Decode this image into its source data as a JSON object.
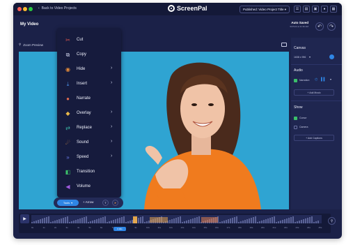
{
  "titlebar": {
    "back_label": "Back to Video Projects",
    "app_name": "ScreenPal",
    "publish_status": "Published: Video Project Title",
    "icons": [
      "list-icon",
      "captions-icon",
      "cc-icon",
      "user-icon",
      "layout-icon"
    ]
  },
  "header": {
    "project_title": "My Video",
    "autosave_label": "Auto Saved",
    "autosave_time": "9/27/22 at 11:36 AM",
    "undo_icon": "undo-icon",
    "redo_icon": "redo-icon"
  },
  "preview": {
    "zoom_label": "Zoom Preview"
  },
  "panel": {
    "canvas_title": "Canvas",
    "canvas_size": "1638 x 996",
    "audio_title": "Audio",
    "narration_label": "Narration",
    "add_music_label": "+ Add Music",
    "show_title": "Show",
    "cursor_label": "Cursor",
    "camera_label": "Camera",
    "add_captions_label": "+ Add Captions",
    "accent": "#2f86e5"
  },
  "menu": {
    "items": [
      {
        "label": "Cut",
        "icon": "scissors-icon",
        "color": "#e2584f",
        "submenu": false
      },
      {
        "label": "Copy",
        "icon": "copy-icon",
        "color": "#c9cde6",
        "submenu": false
      },
      {
        "label": "Hide",
        "icon": "eye-hidden-icon",
        "color": "#e38a3a",
        "submenu": true
      },
      {
        "label": "Insert",
        "icon": "insert-icon",
        "color": "#4a8fe8",
        "submenu": true
      },
      {
        "label": "Narrate",
        "icon": "microphone-icon",
        "color": "#e06b4f",
        "submenu": false
      },
      {
        "label": "Overlay",
        "icon": "layers-icon",
        "color": "#e8b84a",
        "submenu": true
      },
      {
        "label": "Replace",
        "icon": "replace-icon",
        "color": "#3ab8a8",
        "submenu": true
      },
      {
        "label": "Sound",
        "icon": "speaker-icon",
        "color": "#e8974a",
        "submenu": true
      },
      {
        "label": "Speed",
        "icon": "speed-icon",
        "color": "#6a7be8",
        "submenu": true
      },
      {
        "label": "Transition",
        "icon": "transition-icon",
        "color": "#3bbf6a",
        "submenu": false
      },
      {
        "label": "Volume",
        "icon": "volume-icon",
        "color": "#a05be0",
        "submenu": false
      }
    ]
  },
  "toolbar": {
    "tools_label": "Tools",
    "arrow_label": "+ Arrow",
    "text_icon": "text-icon",
    "pointer_icon": "pointer-icon"
  },
  "timeline": {
    "ticks": [
      "0s",
      "1s",
      "2s",
      "3s",
      "4s",
      "5s",
      "6s",
      "7s",
      "8s",
      "9s",
      "10s",
      "11s",
      "12s",
      "13s",
      "14s",
      "15s",
      "16s",
      "17s",
      "18s",
      "19s",
      "20s",
      "21s",
      "22s",
      "23s",
      "24s",
      "25s"
    ],
    "current_time": "6.00s",
    "play_icon": "play-icon",
    "zoom_icon": "search-icon"
  }
}
